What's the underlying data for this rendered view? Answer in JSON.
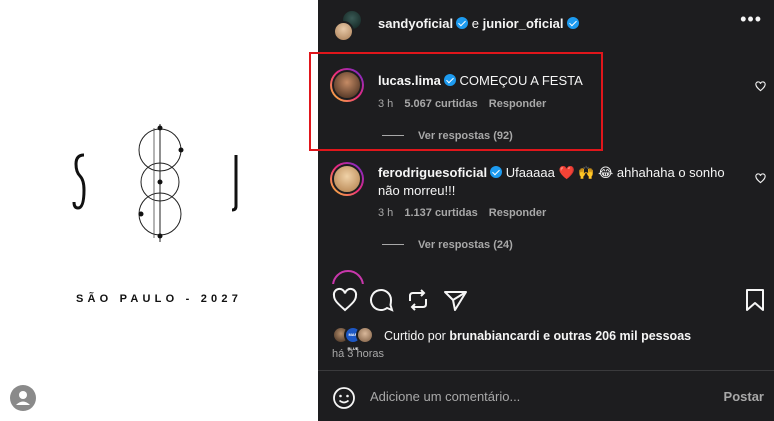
{
  "media": {
    "logo_letters": [
      "S",
      "J"
    ],
    "city_text": "SÃO PAULO - 2027"
  },
  "header": {
    "user1": "sandyoficial",
    "connector": "e",
    "user2": "junior_oficial",
    "more_icon": "more-horizontal-icon"
  },
  "comments": [
    {
      "username": "lucas.lima",
      "verified": true,
      "text": "COMEÇOU A FESTA",
      "time": "3 h",
      "likes": "5.067 curtidas",
      "reply": "Responder",
      "view_replies": "Ver respostas (92)"
    },
    {
      "username": "ferodriguesoficial",
      "verified": true,
      "text": "Ufaaaaa ❤️ 🙌 😂 ahhahaha o sonho não morreu!!!",
      "time": "3 h",
      "likes": "1.137 curtidas",
      "reply": "Responder",
      "view_replies": "Ver respostas (24)"
    }
  ],
  "liked_by": {
    "prefix": "Curtido por",
    "user": "brunabiancardi",
    "suffix": "e outras 206 mil pessoas",
    "mini_label": "MAR BLUE"
  },
  "time_ago": "há 3 horas",
  "comment_box": {
    "placeholder": "Adicione um comentário...",
    "post_label": "Postar"
  },
  "colors": {
    "panel_bg": "#1d1d1f",
    "highlight": "#e0161b",
    "verified": "#1d9bf0"
  }
}
